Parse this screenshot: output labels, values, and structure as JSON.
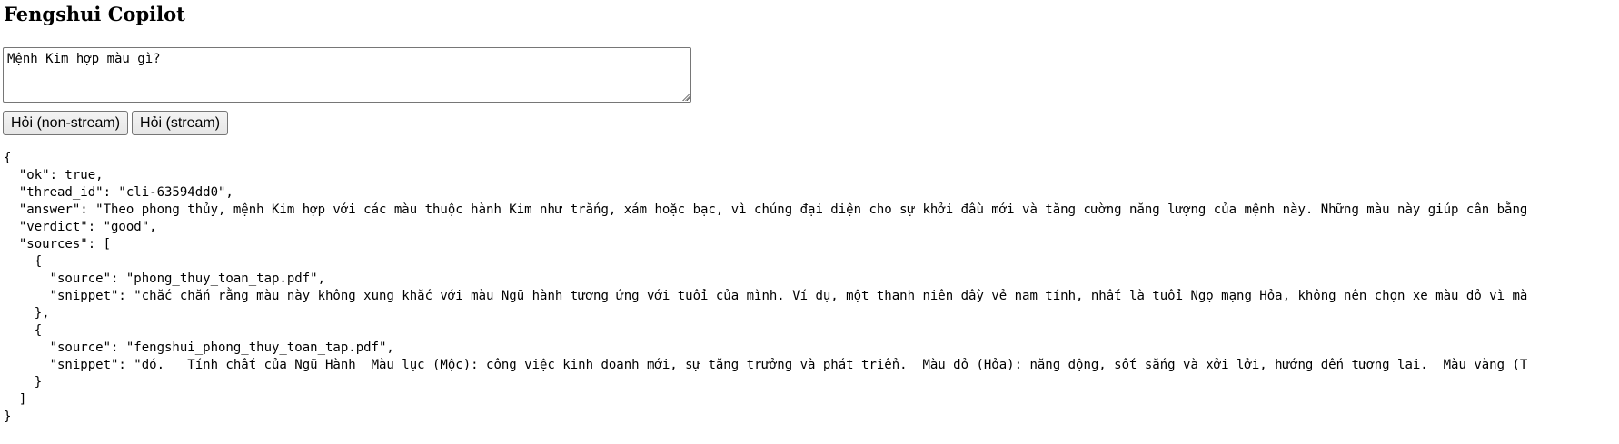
{
  "page": {
    "title": "Fengshui Copilot"
  },
  "question": {
    "value": "Mệnh Kim hợp màu gì?"
  },
  "buttons": {
    "non_stream": "Hỏi (non-stream)",
    "stream": "Hỏi (stream)"
  },
  "response_output": "{\n  \"ok\": true,\n  \"thread_id\": \"cli-63594dd0\",\n  \"answer\": \"Theo phong thủy, mệnh Kim hợp với các màu thuộc hành Kim như trắng, xám hoặc bạc, vì chúng đại diện cho sự khởi đầu mới và tăng cường năng lượng của mệnh này. Những màu này giúp cân bằng\n  \"verdict\": \"good\",\n  \"sources\": [\n    {\n      \"source\": \"phong_thuy_toan_tap.pdf\",\n      \"snippet\": \"chắc chắn rằng màu này không xung khắc với màu Ngũ hành tương ứng với tuổi của mình. Ví dụ, một thanh niên đầy vẻ nam tính, nhất là tuổi Ngọ mạng Hỏa, không nên chọn xe màu đỏ vì mà\n    },\n    {\n      \"source\": \"fengshui_phong_thuy_toan_tap.pdf\",\n      \"snippet\": \"đó.   Tính chất của Ngũ Hành  Màu lục (Mộc): công việc kinh doanh mới, sự tăng trưởng và phát triển.  Màu đỏ (Hỏa): năng động, sốt sắng và xởi lởi, hướng đến tương lai.  Màu vàng (T\n    }\n  ]\n}"
}
